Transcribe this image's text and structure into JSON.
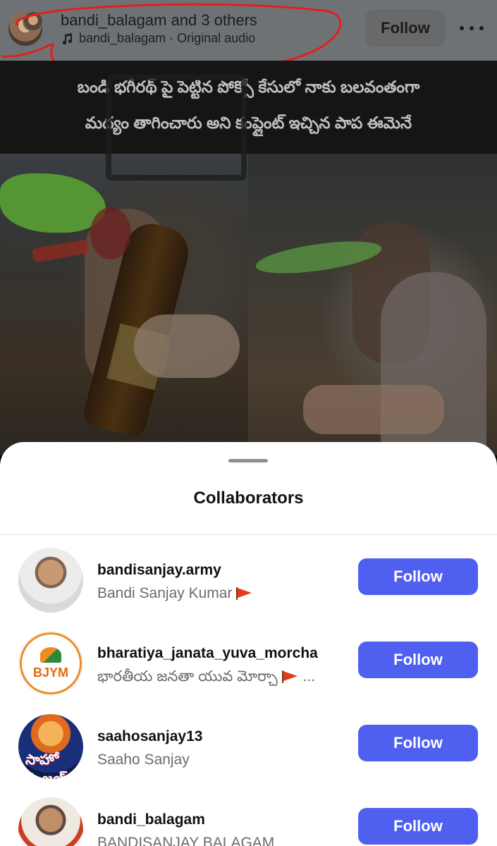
{
  "header": {
    "title_user": "bandi_balagam",
    "title_rest": " and 3 others",
    "audio_user": "bandi_balagam",
    "audio_sep": " · ",
    "audio_label": "Original audio",
    "follow_label": "Follow",
    "more_icon": "more-horizontal-icon"
  },
  "reel": {
    "caption_line1": "బండి భగీరథ్ పై పెట్టిన పోక్సో కేసులో నాకు బలవంతంగా",
    "caption_line2": "మద్యం తాగించారు అని కంప్లైంట్ ఇచ్చిన పాప ఈమెనే"
  },
  "sheet": {
    "title": "Collaborators",
    "collaborators": [
      {
        "username": "bandisanjay.army",
        "full_name": "Bandi Sanjay Kumar",
        "flag": true,
        "follow_label": "Follow"
      },
      {
        "username": "bharatiya_janata_yuva_morcha",
        "full_name": "భారతీయ జనతా యువ మోర్చా",
        "flag": true,
        "ellipsis": " ...",
        "follow_label": "Follow",
        "avatar_text": "BJYM"
      },
      {
        "username": "saahosanjay13",
        "full_name": "Saaho Sanjay",
        "flag": false,
        "follow_label": "Follow",
        "avatar_text": "సాహో సంజయ్"
      },
      {
        "username": "bandi_balagam",
        "full_name": "BANDISANJAY BALAGAM",
        "flag": false,
        "follow_label": "Follow"
      }
    ]
  },
  "colors": {
    "follow_button": "#4f5ff0",
    "annotation_ring": "#e0201c",
    "flag": "#e53a1e"
  }
}
